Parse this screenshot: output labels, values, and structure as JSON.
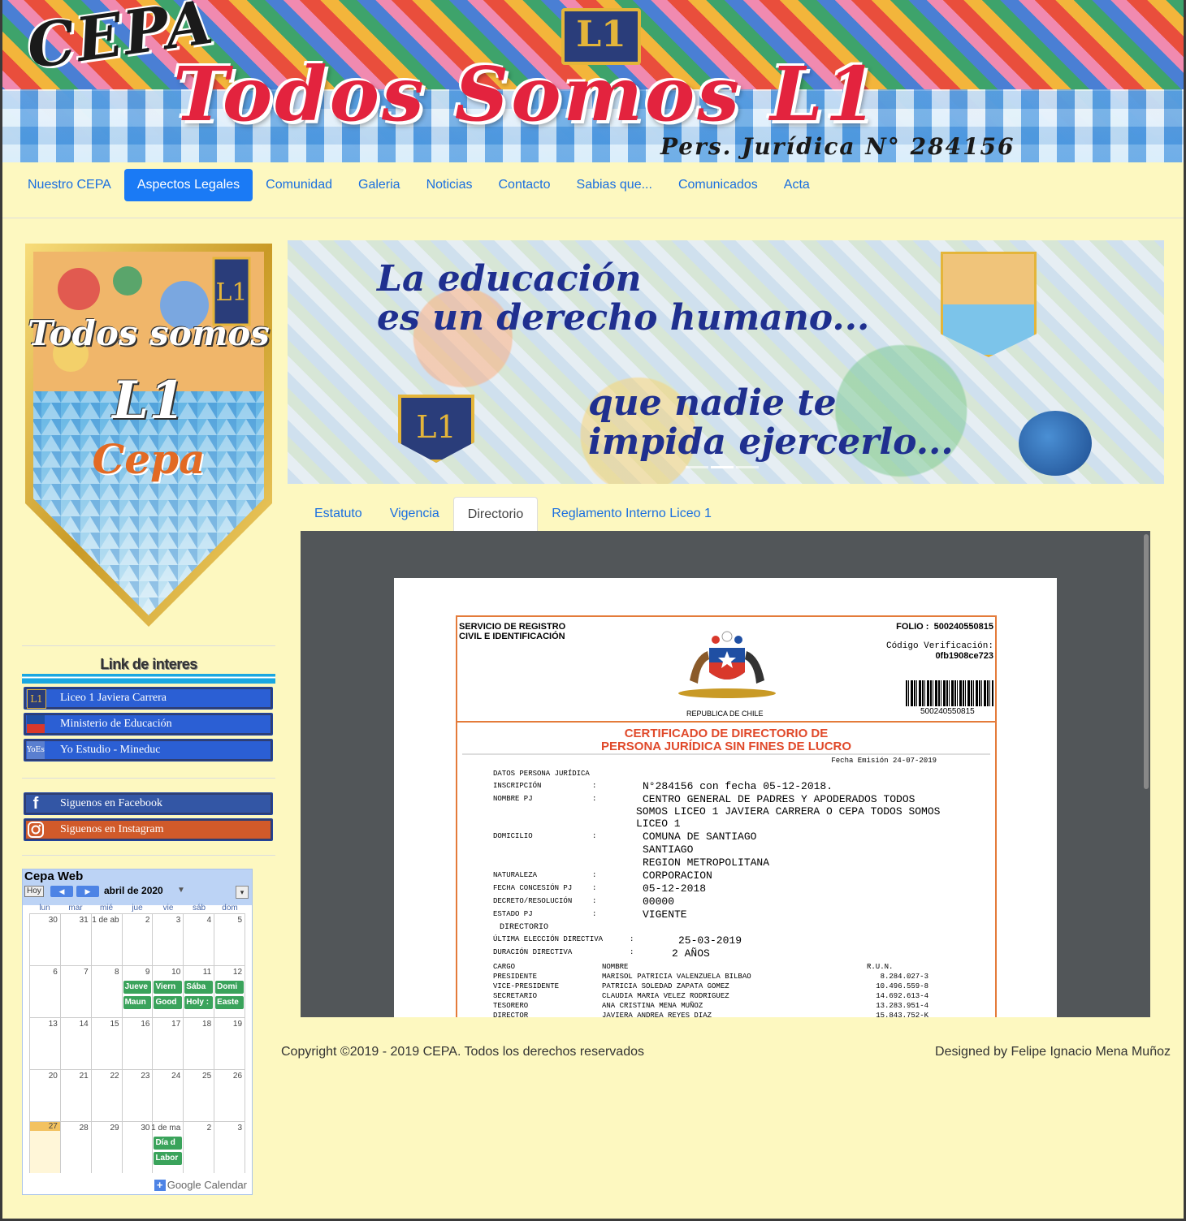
{
  "header": {
    "cepa": "CEPA",
    "badge": "L1",
    "title": "Todos Somos L1",
    "subtitle": "Pers. Jurídica N° 284156"
  },
  "nav": {
    "items": [
      {
        "label": "Nuestro CEPA",
        "active": false
      },
      {
        "label": "Aspectos Legales",
        "active": true
      },
      {
        "label": "Comunidad",
        "active": false
      },
      {
        "label": "Galeria",
        "active": false
      },
      {
        "label": "Noticias",
        "active": false
      },
      {
        "label": "Contacto",
        "active": false
      },
      {
        "label": "Sabias que...",
        "active": false
      },
      {
        "label": "Comunicados",
        "active": false
      },
      {
        "label": "Acta",
        "active": false
      }
    ]
  },
  "sidebar": {
    "pennant": {
      "line1": "Todos somos",
      "line2": "L1",
      "line3": "Cepa"
    },
    "links_title": "Link de interes",
    "links": [
      {
        "icon": "L1",
        "label": "Liceo 1 Javiera Carrera"
      },
      {
        "icon": "mineduc-icon",
        "label": "Ministerio de Educación"
      },
      {
        "icon": "YoEs",
        "label": "Yo Estudio - Mineduc"
      }
    ],
    "social": [
      {
        "icon": "f",
        "label": "Siguenos en Facebook"
      },
      {
        "icon": "instagram-icon",
        "label": "Siguenos en Instagram"
      }
    ]
  },
  "calendar": {
    "title": "Cepa Web",
    "today_label": "Hoy",
    "month": "abril de 2020",
    "dows": [
      "lun",
      "mar",
      "mié",
      "jue",
      "vie",
      "sáb",
      "dom"
    ],
    "weeks": [
      [
        {
          "n": "30"
        },
        {
          "n": "31"
        },
        {
          "n": "1 de ab"
        },
        {
          "n": "2"
        },
        {
          "n": "3"
        },
        {
          "n": "4"
        },
        {
          "n": "5"
        }
      ],
      [
        {
          "n": "6"
        },
        {
          "n": "7"
        },
        {
          "n": "8"
        },
        {
          "n": "9",
          "ev": [
            "Jueve",
            "Maun"
          ]
        },
        {
          "n": "10",
          "ev": [
            "Viern",
            "Good"
          ]
        },
        {
          "n": "11",
          "ev": [
            "Sába",
            "Holy :"
          ]
        },
        {
          "n": "12",
          "ev": [
            "Domi",
            "Easte"
          ]
        }
      ],
      [
        {
          "n": "13"
        },
        {
          "n": "14"
        },
        {
          "n": "15"
        },
        {
          "n": "16"
        },
        {
          "n": "17"
        },
        {
          "n": "18"
        },
        {
          "n": "19"
        }
      ],
      [
        {
          "n": "20"
        },
        {
          "n": "21"
        },
        {
          "n": "22"
        },
        {
          "n": "23"
        },
        {
          "n": "24"
        },
        {
          "n": "25"
        },
        {
          "n": "26"
        }
      ],
      [
        {
          "n": "27",
          "today": true
        },
        {
          "n": "28"
        },
        {
          "n": "29"
        },
        {
          "n": "30"
        },
        {
          "n": "1 de ma",
          "ev": [
            "Día d",
            "Labor"
          ]
        },
        {
          "n": "2"
        },
        {
          "n": "3"
        }
      ]
    ],
    "footer": "Google Calendar"
  },
  "carousel": {
    "line1": "La educación",
    "line2": "es un derecho humano...",
    "line3": "que nadie te",
    "line4": "impida ejercerlo...",
    "shield": "L1"
  },
  "tabs": [
    {
      "label": "Estatuto",
      "active": false
    },
    {
      "label": "Vigencia",
      "active": false
    },
    {
      "label": "Directorio",
      "active": true
    },
    {
      "label": "Reglamento Interno Liceo 1",
      "active": false
    }
  ],
  "certificate": {
    "service_line1": "SERVICIO DE REGISTRO",
    "service_line2": "CIVIL E IDENTIFICACIÓN",
    "folio_label": "FOLIO :",
    "folio": "500240550815",
    "codigo_label": "Código Verificación:",
    "codigo": "0fb1908ce723",
    "republica": "REPUBLICA DE CHILE",
    "barcode_number": "500240550815",
    "title_line1": "CERTIFICADO DE DIRECTORIO DE",
    "title_line2": "PERSONA JURÍDICA SIN FINES DE LUCRO",
    "fecha_emision": "Fecha Emisión 24-07-2019",
    "datos_label": "DATOS PERSONA JURÍDICA",
    "inscripcion_label": "INSCRIPCIÓN",
    "inscripcion": "N°284156 con fecha 05-12-2018.",
    "nombre_label": "NOMBRE PJ",
    "nombre_1": "CENTRO GENERAL DE PADRES Y APODERADOS TODOS",
    "nombre_2": "SOMOS LICEO 1 JAVIERA CARRERA O CEPA TODOS SOMOS",
    "nombre_3": "LICEO 1",
    "domicilio_label": "DOMICILIO",
    "domicilio_1": "COMUNA DE SANTIAGO",
    "domicilio_2": "SANTIAGO",
    "domicilio_3": "REGION METROPOLITANA",
    "naturaleza_label": "NATURALEZA",
    "naturaleza": "CORPORACION",
    "fecha_concesion_label": "FECHA CONCESIÓN PJ",
    "fecha_concesion": "05-12-2018",
    "decreto_label": "DECRETO/RESOLUCIÓN",
    "decreto": "00000",
    "estado_label": "ESTADO PJ",
    "estado": "VIGENTE",
    "directorio_label": "DIRECTORIO",
    "ultima_eleccion_label": "ÚLTIMA ELECCIÓN DIRECTIVA",
    "ultima_eleccion": "25-03-2019",
    "duracion_label": "DURACIÓN DIRECTIVA",
    "duracion": "2 AÑOS",
    "colon": ":",
    "table_headers": [
      "CARGO",
      "NOMBRE",
      "R.U.N."
    ],
    "members": [
      {
        "cargo": "PRESIDENTE",
        "nombre": "MARISOL PATRICIA VALENZUELA BILBAO",
        "run": "8.284.027-3"
      },
      {
        "cargo": "VICE-PRESIDENTE",
        "nombre": "PATRICIA SOLEDAD ZAPATA GOMEZ",
        "run": "10.496.559-8"
      },
      {
        "cargo": "SECRETARIO",
        "nombre": "CLAUDIA MARIA VELEZ RODRIGUEZ",
        "run": "14.692.613-4"
      },
      {
        "cargo": "TESORERO",
        "nombre": "ANA CRISTINA MENA MUÑOZ",
        "run": "13.283.951-4"
      },
      {
        "cargo": "DIRECTOR",
        "nombre": "JAVIERA ANDREA REYES DIAZ",
        "run": "15.843.752-K"
      }
    ]
  },
  "footer": {
    "copyright": "Copyright ©2019 - 2019 CEPA. Todos los derechos reservados",
    "designed": "Designed by Felipe Ignacio Mena Muñoz"
  },
  "colors": {
    "page_bg": "#fdf8c0",
    "nav_active": "#1a7af5",
    "link": "#1a6fe0",
    "cert_orange": "#e47b3a",
    "cert_title": "#e0492a"
  }
}
